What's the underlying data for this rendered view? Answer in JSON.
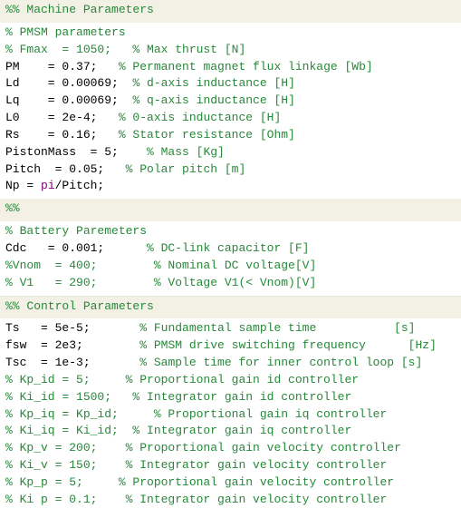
{
  "section1": {
    "header": "%% Machine Parameters",
    "lines": [
      {
        "cls": "c-comment",
        "text": "% PMSM parameters"
      },
      {
        "cls": "c-comment",
        "text": "% Fmax  = 1050;   % Max thrust [N]"
      }
    ],
    "mix": [
      {
        "code": "PM    = 0.37;   ",
        "comment": "% Permanent magnet flux linkage [Wb]"
      },
      {
        "code": "Ld    = 0.00069;  ",
        "comment": "% d-axis inductance [H]"
      },
      {
        "code": "Lq    = 0.00069;  ",
        "comment": "% q-axis inductance [H]"
      },
      {
        "code": "L0    = 2e-4;   ",
        "comment": "% 0-axis inductance [H]"
      },
      {
        "code": "Rs    = 0.16;   ",
        "comment": "% Stator resistance [Ohm]"
      },
      {
        "code": "PistonMass  = 5;    ",
        "comment": "% Mass [Kg]"
      },
      {
        "code": "Pitch  = 0.05;   ",
        "comment": "% Polar pitch [m]"
      }
    ],
    "np": {
      "pre": "Np = ",
      "kw": "pi",
      "post": "/Pitch;"
    }
  },
  "section2": {
    "header": "%%",
    "lines": [
      {
        "cls": "c-comment",
        "text": "% Battery Paremeters"
      }
    ],
    "mix": [
      {
        "code": "Cdc   = 0.001;      ",
        "comment": "% DC-link capacitor [F]"
      }
    ],
    "tail": [
      {
        "cls": "c-comment",
        "text": "%Vnom  = 400;        % Nominal DC voltage[V]"
      },
      {
        "cls": "c-comment",
        "text": "% V1   = 290;        % Voltage V1(< Vnom)[V]"
      }
    ]
  },
  "section3": {
    "header": "%% Control Parameters",
    "mix": [
      {
        "code": "Ts   = 5e-5;       ",
        "comment": "% Fundamental sample time           [s]"
      },
      {
        "code": "fsw  = 2e3;        ",
        "comment": "% PMSM drive switching frequency      [Hz]"
      },
      {
        "code": "Tsc  = 1e-3;       ",
        "comment": "% Sample time for inner control loop [s]"
      }
    ],
    "tail": [
      {
        "cls": "c-comment",
        "text": ""
      },
      {
        "cls": "c-comment",
        "text": "% Kp_id = 5;     % Proportional gain id controller"
      },
      {
        "cls": "c-comment",
        "text": "% Ki_id = 1500;   % Integrator gain id controller"
      },
      {
        "cls": "c-comment",
        "text": "% Kp_iq = Kp_id;     % Proportional gain iq controller"
      },
      {
        "cls": "c-comment",
        "text": "% Ki_iq = Ki_id;  % Integrator gain iq controller"
      },
      {
        "cls": "c-comment",
        "text": ""
      },
      {
        "cls": "c-comment",
        "text": "% Kp_v = 200;    % Proportional gain velocity controller"
      },
      {
        "cls": "c-comment",
        "text": "% Ki_v = 150;    % Integrator gain velocity controller"
      },
      {
        "cls": "c-comment",
        "text": ""
      },
      {
        "cls": "c-comment",
        "text": "% Kp_p = 5;     % Proportional gain velocity controller"
      },
      {
        "cls": "c-comment",
        "text": "% Ki p = 0.1;    % Integrator gain velocity controller"
      }
    ]
  }
}
